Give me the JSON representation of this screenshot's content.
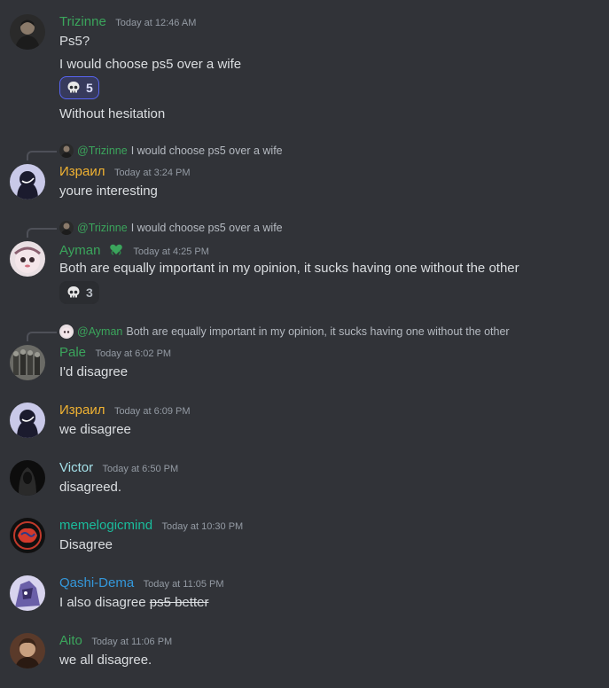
{
  "messages": [
    {
      "author": "Trizinne",
      "color": "#3ba55c",
      "timestamp": "Today at 12:46 AM",
      "lines": [
        "Ps5?",
        "I would choose ps5 over a wife"
      ],
      "reaction": {
        "icon": "skull-icon",
        "count": "5"
      },
      "after": "Without hesitation"
    },
    {
      "reply": {
        "mention": "@Trizinne",
        "text": "I would choose ps5 over a wife"
      },
      "author": "Израил",
      "color": "#f0b232",
      "timestamp": "Today at 3:24 PM",
      "text": "youre interesting"
    },
    {
      "reply": {
        "mention": "@Trizinne",
        "text": "I would choose ps5 over a wife"
      },
      "author": "Ayman",
      "color": "#3ba55c",
      "badge": "heart-hands-icon",
      "timestamp": "Today at 4:25 PM",
      "text": "Both are equally important in my opinion, it sucks having one without the other",
      "reaction": {
        "icon": "skull-icon",
        "count": "3"
      }
    },
    {
      "reply": {
        "mention": "@Ayman",
        "text": "Both are equally important in my opinion, it sucks having one without the other"
      },
      "author": "Pale",
      "color": "#3ba55c",
      "timestamp": "Today at 6:02 PM",
      "text": "I'd disagree"
    },
    {
      "author": "Израил",
      "color": "#f0b232",
      "timestamp": "Today at 6:09 PM",
      "text": "we disagree"
    },
    {
      "author": "Victor",
      "color": "#a4e0e8",
      "timestamp": "Today at 6:50 PM",
      "text": "disagreed."
    },
    {
      "author": "memelogicmind",
      "color": "#1abc9c",
      "timestamp": "Today at 10:30 PM",
      "text": "Disagree"
    },
    {
      "author": "Qashi-Dema",
      "color": "#3498db",
      "timestamp": "Today at 11:05 PM",
      "text": "I also disagree ",
      "strike": "ps5 better"
    },
    {
      "author": "Aito",
      "color": "#3ba55c",
      "timestamp": "Today at 11:06 PM",
      "text": "we all disagree."
    }
  ]
}
